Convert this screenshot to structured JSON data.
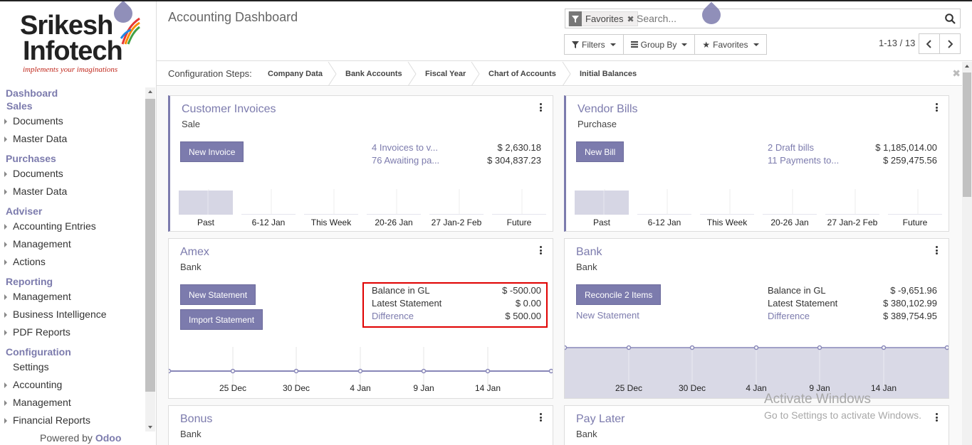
{
  "logo": {
    "line1": "Srikesh",
    "line2": "Infotech",
    "tagline": "implements your imaginations"
  },
  "sidebar": {
    "sections": [
      {
        "title": "Dashboard",
        "items": []
      },
      {
        "title": "Sales",
        "items": [
          "Documents",
          "Master Data"
        ]
      },
      {
        "title": "Purchases",
        "items": [
          "Documents",
          "Master Data"
        ]
      },
      {
        "title": "Adviser",
        "items": [
          "Accounting Entries",
          "Management",
          "Actions"
        ]
      },
      {
        "title": "Reporting",
        "items": [
          "Management",
          "Business Intelligence",
          "PDF Reports"
        ]
      },
      {
        "title": "Configuration",
        "items": [
          "Settings",
          "Accounting",
          "Management",
          "Financial Reports"
        ]
      }
    ],
    "powered_prefix": "Powered by",
    "powered_brand": "Odoo"
  },
  "header": {
    "title": "Accounting Dashboard",
    "facet": "Favorites",
    "search_placeholder": "Search...",
    "filters": "Filters",
    "group_by": "Group By",
    "favorites": "Favorites",
    "pager": "1-13 / 13"
  },
  "config": {
    "label": "Configuration Steps:",
    "steps": [
      "Company Data",
      "Bank Accounts",
      "Fiscal Year",
      "Chart of Accounts",
      "Initial Balances"
    ]
  },
  "cards": {
    "customer_invoices": {
      "title": "Customer Invoices",
      "subtitle": "Sale",
      "button": "New Invoice",
      "rows": [
        {
          "label": "4 Invoices to v...",
          "amount": "$ 2,630.18"
        },
        {
          "label": "76 Awaiting pa...",
          "amount": "$ 304,837.23"
        }
      ],
      "chart": {
        "type": "bar",
        "categories": [
          "Past",
          "6-12 Jan",
          "This Week",
          "20-26 Jan",
          "27 Jan-2 Feb",
          "Future"
        ],
        "values": [
          2630.18,
          0,
          0,
          0,
          0,
          0
        ]
      }
    },
    "vendor_bills": {
      "title": "Vendor Bills",
      "subtitle": "Purchase",
      "button": "New Bill",
      "rows": [
        {
          "label": "2 Draft bills",
          "amount": "$ 1,185,014.00"
        },
        {
          "label": "11 Payments to...",
          "amount": "$ 259,475.56"
        }
      ],
      "chart": {
        "type": "bar",
        "categories": [
          "Past",
          "6-12 Jan",
          "This Week",
          "20-26 Jan",
          "27 Jan-2 Feb",
          "Future"
        ],
        "values": [
          1185014,
          0,
          0,
          0,
          0,
          0
        ]
      }
    },
    "amex": {
      "title": "Amex",
      "subtitle": "Bank",
      "button1": "New Statement",
      "button2": "Import Statement",
      "rows": [
        {
          "label": "Balance in GL",
          "amount": "$ -500.00"
        },
        {
          "label": "Latest Statement",
          "amount": "$ 0.00"
        },
        {
          "label": "Difference",
          "amount": "$ 500.00"
        }
      ],
      "chart": {
        "type": "line",
        "x": [
          "25 Dec",
          "30 Dec",
          "4 Jan",
          "9 Jan",
          "14 Jan"
        ]
      }
    },
    "bank": {
      "title": "Bank",
      "subtitle": "Bank",
      "button": "Reconcile 2 Items",
      "link": "New Statement",
      "rows": [
        {
          "label": "Balance in GL",
          "amount": "$ -9,651.96"
        },
        {
          "label": "Latest Statement",
          "amount": "$ 380,102.99"
        },
        {
          "label": "Difference",
          "amount": "$ 389,754.95"
        }
      ],
      "chart": {
        "type": "area",
        "x": [
          "25 Dec",
          "30 Dec",
          "4 Jan",
          "9 Jan",
          "14 Jan"
        ]
      }
    },
    "bonus": {
      "title": "Bonus",
      "subtitle": "Bank"
    },
    "pay_later": {
      "title": "Pay Later",
      "subtitle": "Bank"
    }
  },
  "watermark": {
    "line1": "Activate Windows",
    "line2": "Go to Settings to activate Windows."
  }
}
